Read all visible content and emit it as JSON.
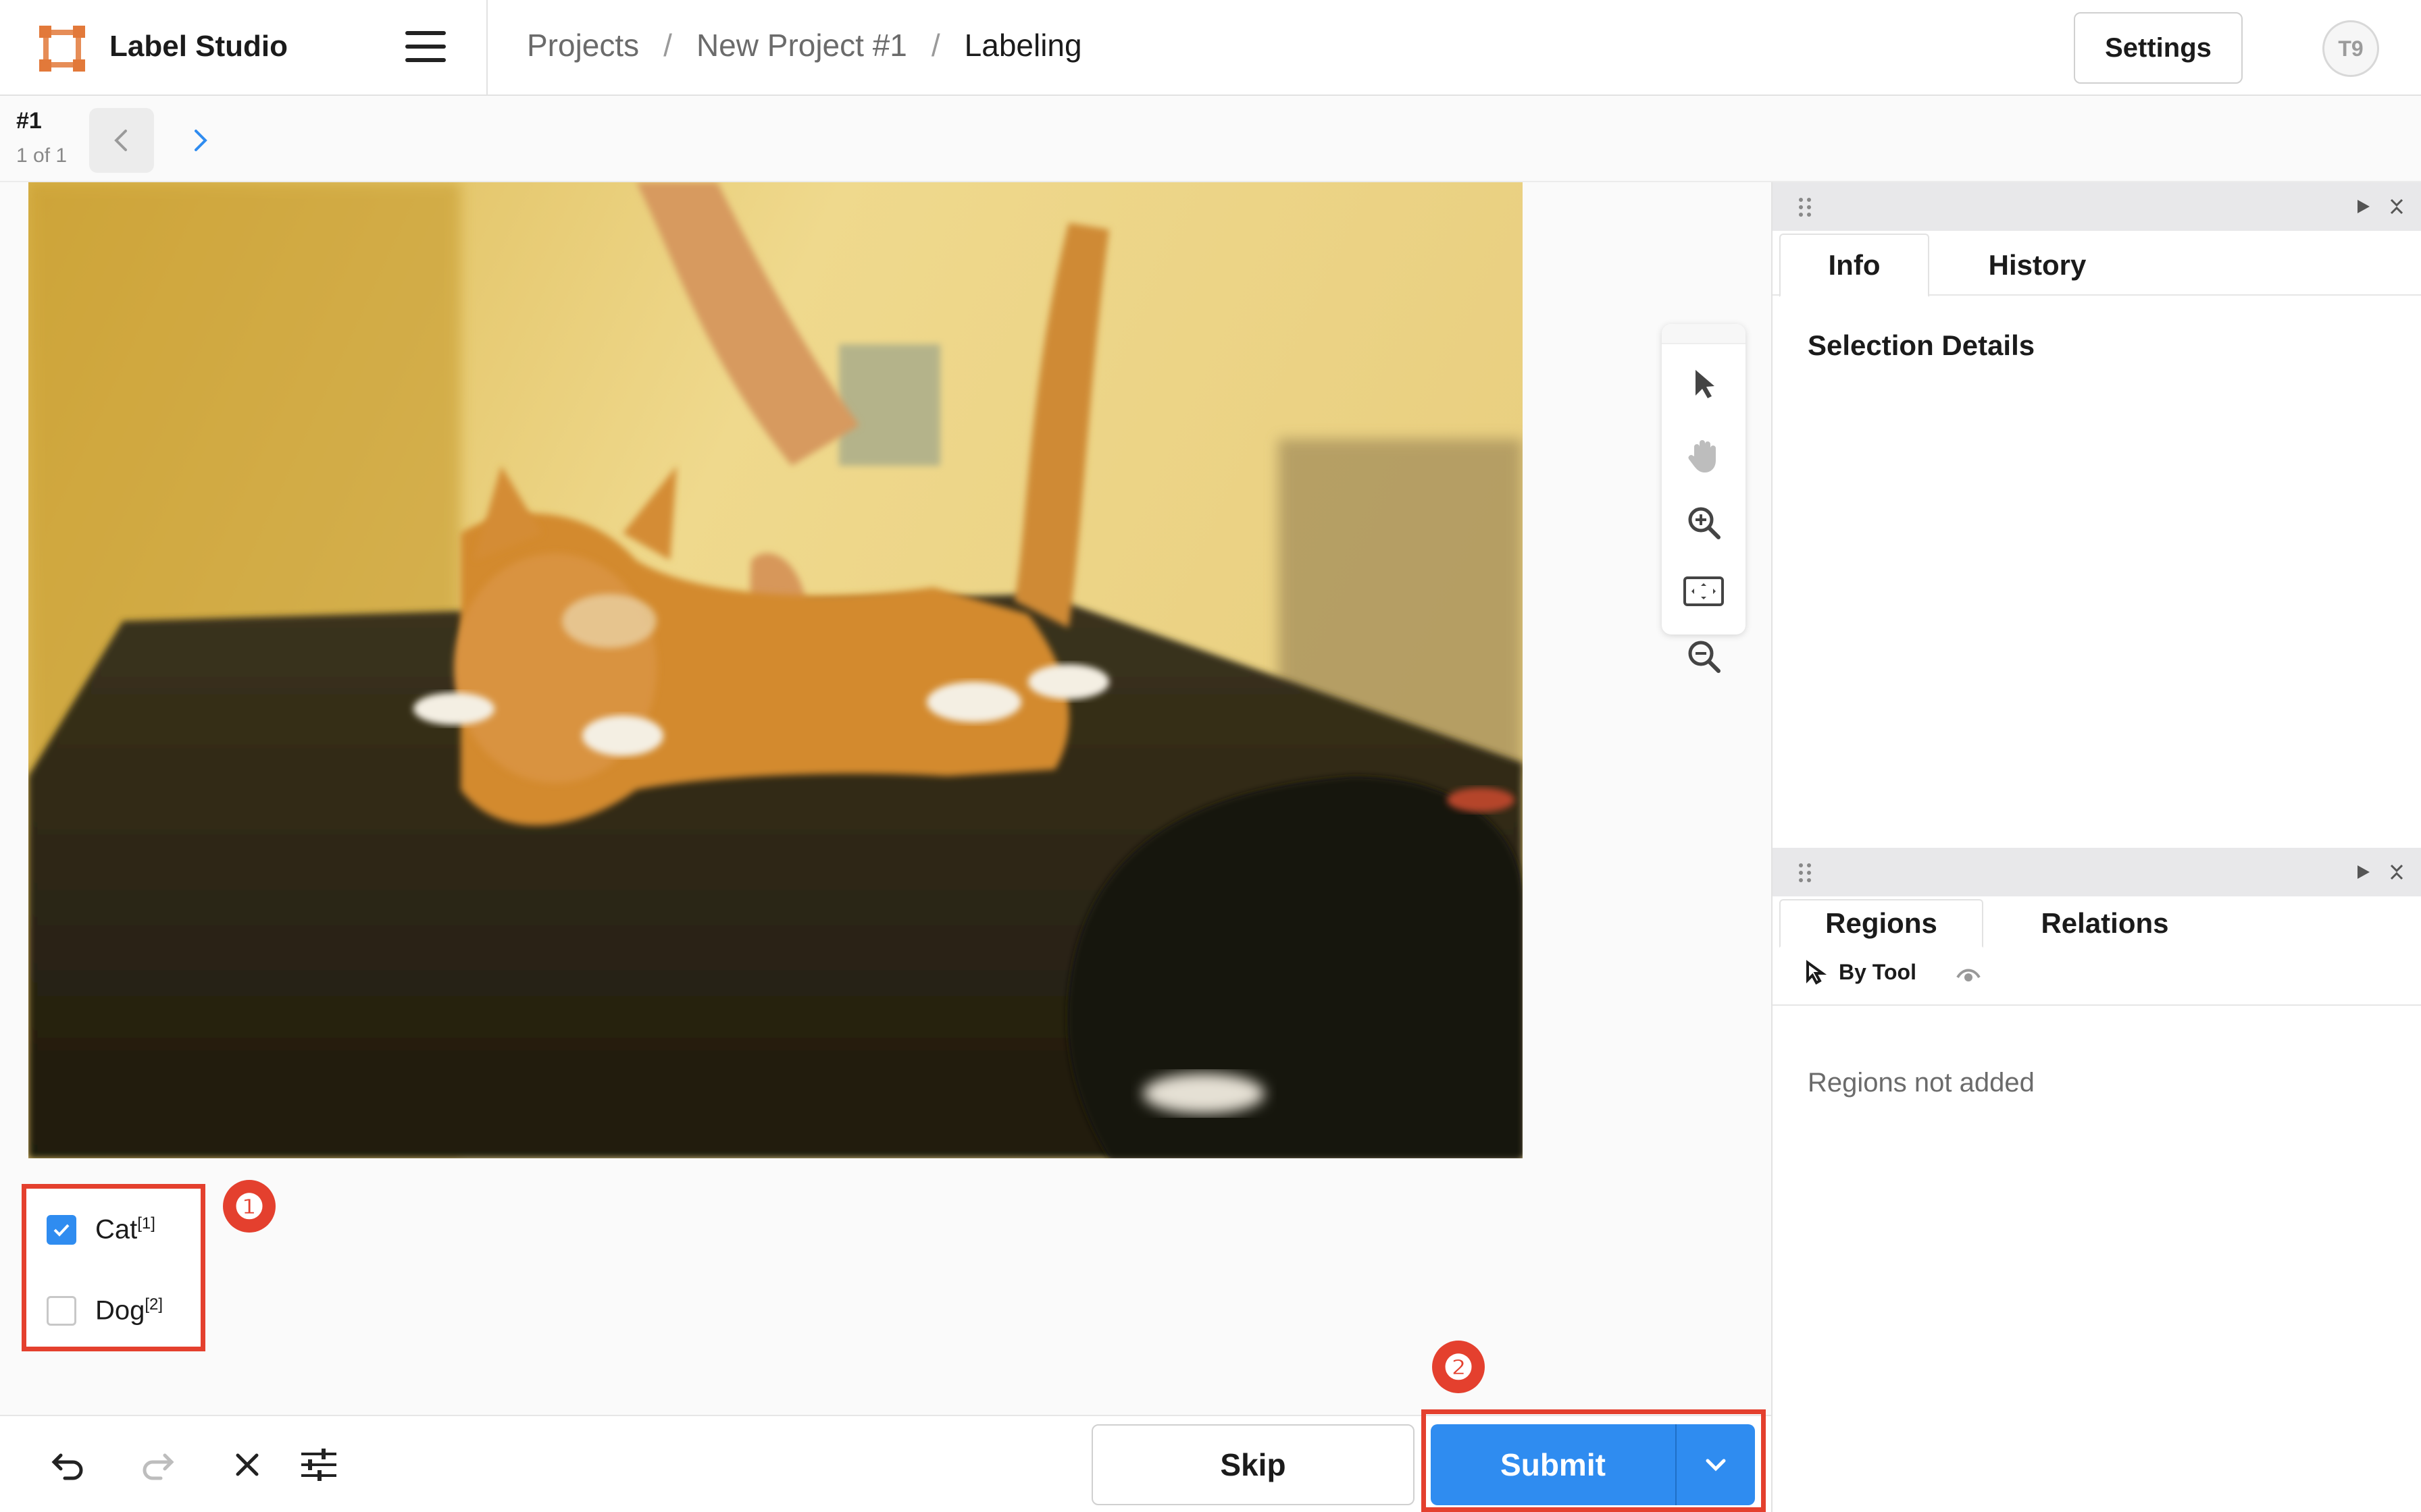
{
  "app": {
    "title": "Label Studio"
  },
  "breadcrumb": {
    "items": [
      "Projects",
      "New Project #1",
      "Labeling"
    ],
    "separator": "/"
  },
  "header": {
    "settings_label": "Settings",
    "avatar_initials": "T9"
  },
  "task_nav": {
    "task_id": "#1",
    "count_text": "1 of 1"
  },
  "choices": [
    {
      "label": "Cat",
      "hotkey": "[1]",
      "checked": true
    },
    {
      "label": "Dog",
      "hotkey": "[2]",
      "checked": false
    }
  ],
  "markers": [
    "❶",
    "❷"
  ],
  "bottom": {
    "skip_label": "Skip",
    "submit_label": "Submit"
  },
  "sidebar": {
    "top_tabs": [
      "Info",
      "History"
    ],
    "selection_details_title": "Selection Details",
    "bottom_tabs": [
      "Regions",
      "Relations"
    ],
    "group_by_label": "By Tool",
    "empty_regions_text": "Regions not added"
  },
  "colors": {
    "accent": "#2f8cf0",
    "highlight": "#e4402e",
    "logo": "#e2793a"
  }
}
